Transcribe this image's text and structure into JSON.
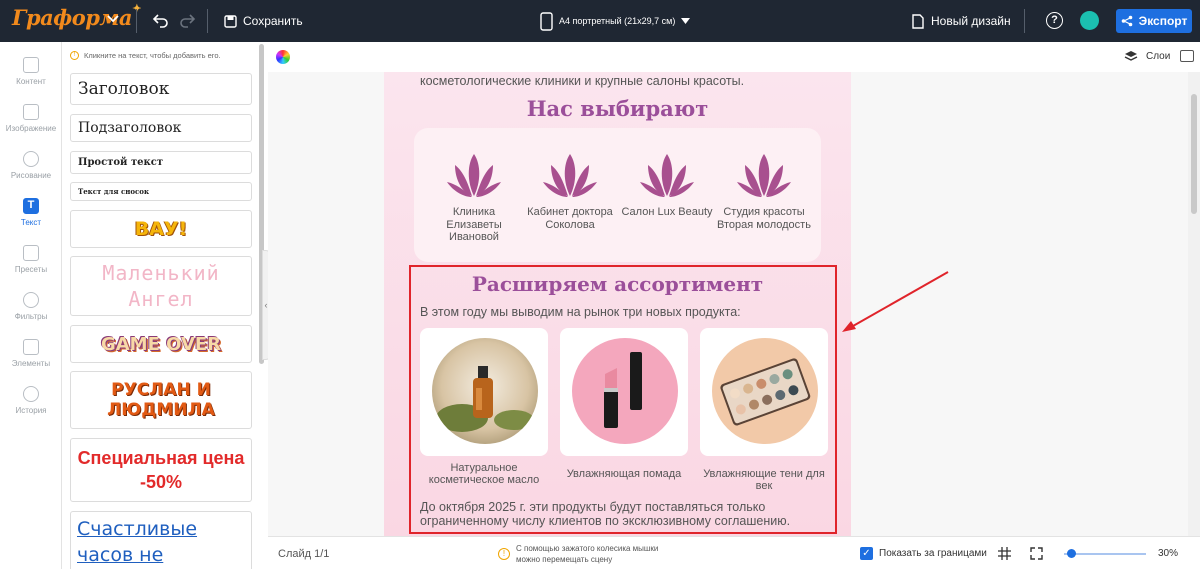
{
  "app": {
    "logo": "Граформа",
    "save_label": "Сохранить",
    "format_label": "A4 портретный (21x29,7 см)",
    "new_design_label": "Новый дизайн",
    "help_label": "?",
    "export_label": "Экспорт",
    "accent": "#1e6fe0"
  },
  "sidebar": {
    "items": [
      {
        "label": "Контент",
        "icon": "content-icon"
      },
      {
        "label": "Изображение",
        "icon": "image-icon"
      },
      {
        "label": "Рисование",
        "icon": "draw-icon"
      },
      {
        "label": "Текст",
        "icon": "text-icon",
        "active": true
      },
      {
        "label": "Пресеты",
        "icon": "presets-icon"
      },
      {
        "label": "Фильтры",
        "icon": "filters-icon"
      },
      {
        "label": "Элементы",
        "icon": "elements-icon"
      },
      {
        "label": "История",
        "icon": "history-icon"
      }
    ]
  },
  "text_panel": {
    "hint": "Кликните на текст, чтобы добавить его.",
    "styles": [
      "Заголовок",
      "Подзаголовок",
      "Простой текст",
      "Текст для сносок"
    ],
    "presets": [
      "ВАУ!",
      "Маленький Ангел",
      "GAME OVER",
      "РУСЛАН И ЛЮДМИЛА",
      "Специальная цена -50%",
      "Счастливые часов не наблюдают"
    ]
  },
  "canvas": {
    "layers_label": "Слои",
    "intro_line": "косметологические клиники и крупные салоны красоты.",
    "section1_title": "Нас выбирают",
    "clients": [
      "Клиника Елизаветы Ивановой",
      "Кабинет доктора Соколова",
      "Салон Lux Beauty",
      "Студия красоты Вторая молодость"
    ],
    "section2_title": "Расширяем ассортимент",
    "section2_intro": "В этом году мы выводим на рынок три новых продукта:",
    "products": [
      "Натуральное косметическое масло",
      "Увлажняющая помада",
      "Увлажняющие тени для век"
    ],
    "footer_note": "До октября 2025 г. эти продукты будут поставляться только ограниченному числу клиентов по эксклюзивному соглашению."
  },
  "bottombar": {
    "slide_label": "Слайд 1/1",
    "tip": "С помощью зажатого колесика мышки можно перемещать сцену",
    "show_outside_label": "Показать за границами",
    "zoom": "30%"
  }
}
